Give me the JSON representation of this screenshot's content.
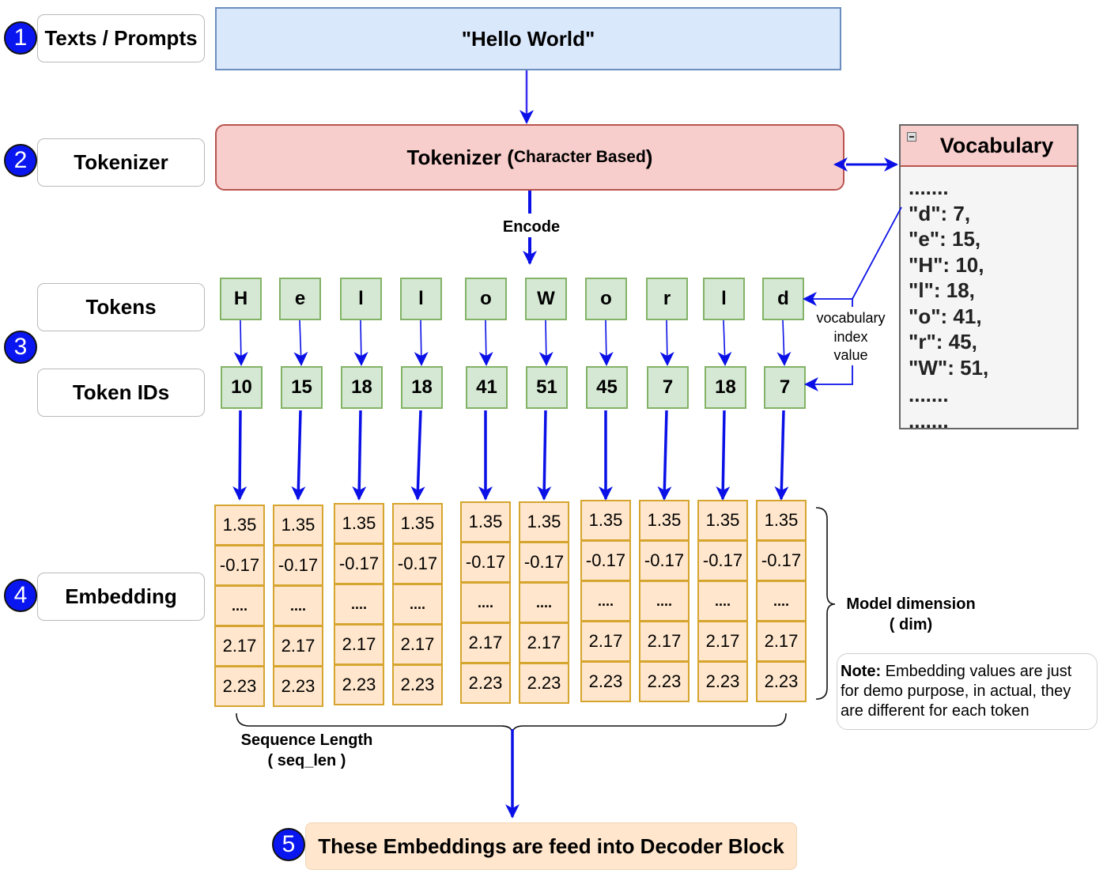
{
  "steps": [
    {
      "number": "1",
      "label": "Texts / Prompts"
    },
    {
      "number": "2",
      "label": "Tokenizer"
    },
    {
      "number": "3",
      "labels": [
        "Tokens",
        "Token IDs"
      ]
    },
    {
      "number": "4",
      "label": "Embedding"
    },
    {
      "number": "5",
      "label": "These Embeddings are feed into Decoder Block"
    }
  ],
  "input_text": "\"Hello World\"",
  "tokenizer": {
    "title": "Tokenizer (",
    "subtitle": "Character Based",
    "close": ")"
  },
  "encode_label": "Encode",
  "vocabulary": {
    "title": "Vocabulary",
    "lines": [
      ".......",
      "\"d\": 7,",
      "\"e\": 15,",
      "\"H\": 10,",
      "\"l\": 18,",
      "\"o\": 41,",
      "\"r\": 45,",
      "\"W\": 51,",
      ".......",
      "......."
    ]
  },
  "vocab_lookup_label": "vocabulary\nindex\nvalue",
  "tokens": [
    "H",
    "e",
    "l",
    "l",
    "o",
    "W",
    "o",
    "r",
    "l",
    "d"
  ],
  "token_ids": [
    "10",
    "15",
    "18",
    "18",
    "41",
    "51",
    "45",
    "7",
    "18",
    "7"
  ],
  "embedding_values": [
    "1.35",
    "-0.17",
    "....",
    "2.17",
    "2.23"
  ],
  "model_dimension_label": "Model dimension",
  "model_dimension_sub": "( dim)",
  "sequence_length_label": "Sequence Length",
  "sequence_length_sub": "( seq_len )",
  "note": {
    "bold": "Note:",
    "text": " Embedding values are just for demo purpose, in actual, they are different for each token"
  },
  "colors": {
    "arrow": "#0a10e6",
    "badge": "#0a16f0",
    "input_fill": "#dae8fc",
    "tokenizer_fill": "#f8cecc",
    "token_fill": "#d5e8d4",
    "embedding_fill": "#ffe6cc"
  }
}
